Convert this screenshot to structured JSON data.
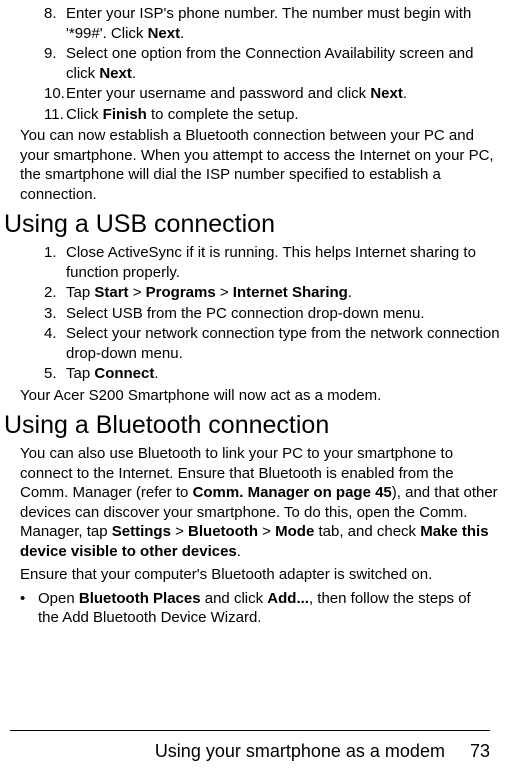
{
  "intro_steps": [
    {
      "num": "8.",
      "parts": [
        "Enter your ISP's phone number. The number must begin with '*99#'. Click ",
        "Next",
        "."
      ]
    },
    {
      "num": "9.",
      "parts": [
        "Select one option from the Connection Availability screen and click ",
        "Next",
        "."
      ]
    },
    {
      "num": "10.",
      "parts": [
        "Enter your username and password and click ",
        "Next",
        "."
      ]
    },
    {
      "num": "11.",
      "parts": [
        "Click ",
        "Finish",
        " to complete the setup."
      ]
    }
  ],
  "intro_followup": "You can now establish a Bluetooth connection between your PC and your smartphone. When you attempt to access the Internet on your PC, the smartphone will dial the ISP number specified to establish a connection.",
  "usb": {
    "heading": "Using a USB connection",
    "steps": [
      {
        "num": "1.",
        "parts": [
          "Close ActiveSync if it is running. This helps Internet sharing to function properly."
        ]
      },
      {
        "num": "2.",
        "parts": [
          "Tap ",
          "Start",
          " > ",
          "Programs",
          " > ",
          "Internet Sharing",
          "."
        ]
      },
      {
        "num": "3.",
        "parts": [
          "Select USB from the PC connection drop-down menu."
        ]
      },
      {
        "num": "4.",
        "parts": [
          "Select your network connection type from the network con",
          "nection drop-down menu."
        ]
      },
      {
        "num": "5.",
        "parts": [
          "Tap ",
          "Connect",
          "."
        ]
      }
    ],
    "followup": "Your Acer S200 Smartphone will now act as a modem."
  },
  "bt": {
    "heading": "Using a Bluetooth connection",
    "para1_parts": [
      "You can also use Bluetooth to link your PC to your smartphone to connect to the Internet. Ensure that Bluetooth is enabled from the Comm. Manager (refer to ",
      "Comm. Manager on page 45",
      "), and that other devices can discover your smart",
      "phone. To do this, open the Comm. Manager, tap ",
      "Settings",
      " > ",
      "Bluetooth",
      "  > ",
      "Mode",
      " tab, and check ",
      "Make this device visible to other devices",
      "."
    ],
    "para2": "Ensure that your computer's Bluetooth adapter is switched on.",
    "bullet_parts": [
      "Open ",
      "Bluetooth Places",
      " and click ",
      "Add...",
      ", then follow the steps of the Add Bluetooth Device Wizard."
    ]
  },
  "footer": {
    "title": "Using your smartphone as a modem",
    "page": "73"
  }
}
